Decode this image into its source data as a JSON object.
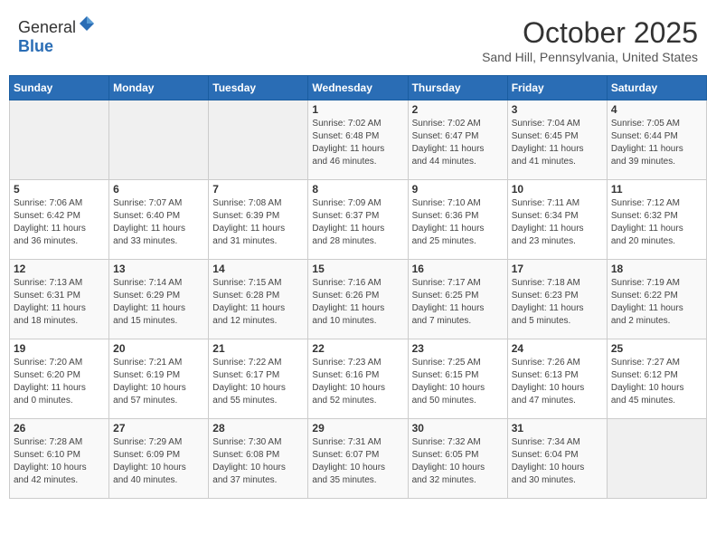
{
  "header": {
    "logo_general": "General",
    "logo_blue": "Blue",
    "month": "October 2025",
    "location": "Sand Hill, Pennsylvania, United States"
  },
  "weekdays": [
    "Sunday",
    "Monday",
    "Tuesday",
    "Wednesday",
    "Thursday",
    "Friday",
    "Saturday"
  ],
  "weeks": [
    [
      {
        "day": "",
        "info": ""
      },
      {
        "day": "",
        "info": ""
      },
      {
        "day": "",
        "info": ""
      },
      {
        "day": "1",
        "info": "Sunrise: 7:02 AM\nSunset: 6:48 PM\nDaylight: 11 hours\nand 46 minutes."
      },
      {
        "day": "2",
        "info": "Sunrise: 7:02 AM\nSunset: 6:47 PM\nDaylight: 11 hours\nand 44 minutes."
      },
      {
        "day": "3",
        "info": "Sunrise: 7:04 AM\nSunset: 6:45 PM\nDaylight: 11 hours\nand 41 minutes."
      },
      {
        "day": "4",
        "info": "Sunrise: 7:05 AM\nSunset: 6:44 PM\nDaylight: 11 hours\nand 39 minutes."
      }
    ],
    [
      {
        "day": "5",
        "info": "Sunrise: 7:06 AM\nSunset: 6:42 PM\nDaylight: 11 hours\nand 36 minutes."
      },
      {
        "day": "6",
        "info": "Sunrise: 7:07 AM\nSunset: 6:40 PM\nDaylight: 11 hours\nand 33 minutes."
      },
      {
        "day": "7",
        "info": "Sunrise: 7:08 AM\nSunset: 6:39 PM\nDaylight: 11 hours\nand 31 minutes."
      },
      {
        "day": "8",
        "info": "Sunrise: 7:09 AM\nSunset: 6:37 PM\nDaylight: 11 hours\nand 28 minutes."
      },
      {
        "day": "9",
        "info": "Sunrise: 7:10 AM\nSunset: 6:36 PM\nDaylight: 11 hours\nand 25 minutes."
      },
      {
        "day": "10",
        "info": "Sunrise: 7:11 AM\nSunset: 6:34 PM\nDaylight: 11 hours\nand 23 minutes."
      },
      {
        "day": "11",
        "info": "Sunrise: 7:12 AM\nSunset: 6:32 PM\nDaylight: 11 hours\nand 20 minutes."
      }
    ],
    [
      {
        "day": "12",
        "info": "Sunrise: 7:13 AM\nSunset: 6:31 PM\nDaylight: 11 hours\nand 18 minutes."
      },
      {
        "day": "13",
        "info": "Sunrise: 7:14 AM\nSunset: 6:29 PM\nDaylight: 11 hours\nand 15 minutes."
      },
      {
        "day": "14",
        "info": "Sunrise: 7:15 AM\nSunset: 6:28 PM\nDaylight: 11 hours\nand 12 minutes."
      },
      {
        "day": "15",
        "info": "Sunrise: 7:16 AM\nSunset: 6:26 PM\nDaylight: 11 hours\nand 10 minutes."
      },
      {
        "day": "16",
        "info": "Sunrise: 7:17 AM\nSunset: 6:25 PM\nDaylight: 11 hours\nand 7 minutes."
      },
      {
        "day": "17",
        "info": "Sunrise: 7:18 AM\nSunset: 6:23 PM\nDaylight: 11 hours\nand 5 minutes."
      },
      {
        "day": "18",
        "info": "Sunrise: 7:19 AM\nSunset: 6:22 PM\nDaylight: 11 hours\nand 2 minutes."
      }
    ],
    [
      {
        "day": "19",
        "info": "Sunrise: 7:20 AM\nSunset: 6:20 PM\nDaylight: 11 hours\nand 0 minutes."
      },
      {
        "day": "20",
        "info": "Sunrise: 7:21 AM\nSunset: 6:19 PM\nDaylight: 10 hours\nand 57 minutes."
      },
      {
        "day": "21",
        "info": "Sunrise: 7:22 AM\nSunset: 6:17 PM\nDaylight: 10 hours\nand 55 minutes."
      },
      {
        "day": "22",
        "info": "Sunrise: 7:23 AM\nSunset: 6:16 PM\nDaylight: 10 hours\nand 52 minutes."
      },
      {
        "day": "23",
        "info": "Sunrise: 7:25 AM\nSunset: 6:15 PM\nDaylight: 10 hours\nand 50 minutes."
      },
      {
        "day": "24",
        "info": "Sunrise: 7:26 AM\nSunset: 6:13 PM\nDaylight: 10 hours\nand 47 minutes."
      },
      {
        "day": "25",
        "info": "Sunrise: 7:27 AM\nSunset: 6:12 PM\nDaylight: 10 hours\nand 45 minutes."
      }
    ],
    [
      {
        "day": "26",
        "info": "Sunrise: 7:28 AM\nSunset: 6:10 PM\nDaylight: 10 hours\nand 42 minutes."
      },
      {
        "day": "27",
        "info": "Sunrise: 7:29 AM\nSunset: 6:09 PM\nDaylight: 10 hours\nand 40 minutes."
      },
      {
        "day": "28",
        "info": "Sunrise: 7:30 AM\nSunset: 6:08 PM\nDaylight: 10 hours\nand 37 minutes."
      },
      {
        "day": "29",
        "info": "Sunrise: 7:31 AM\nSunset: 6:07 PM\nDaylight: 10 hours\nand 35 minutes."
      },
      {
        "day": "30",
        "info": "Sunrise: 7:32 AM\nSunset: 6:05 PM\nDaylight: 10 hours\nand 32 minutes."
      },
      {
        "day": "31",
        "info": "Sunrise: 7:34 AM\nSunset: 6:04 PM\nDaylight: 10 hours\nand 30 minutes."
      },
      {
        "day": "",
        "info": ""
      }
    ]
  ]
}
